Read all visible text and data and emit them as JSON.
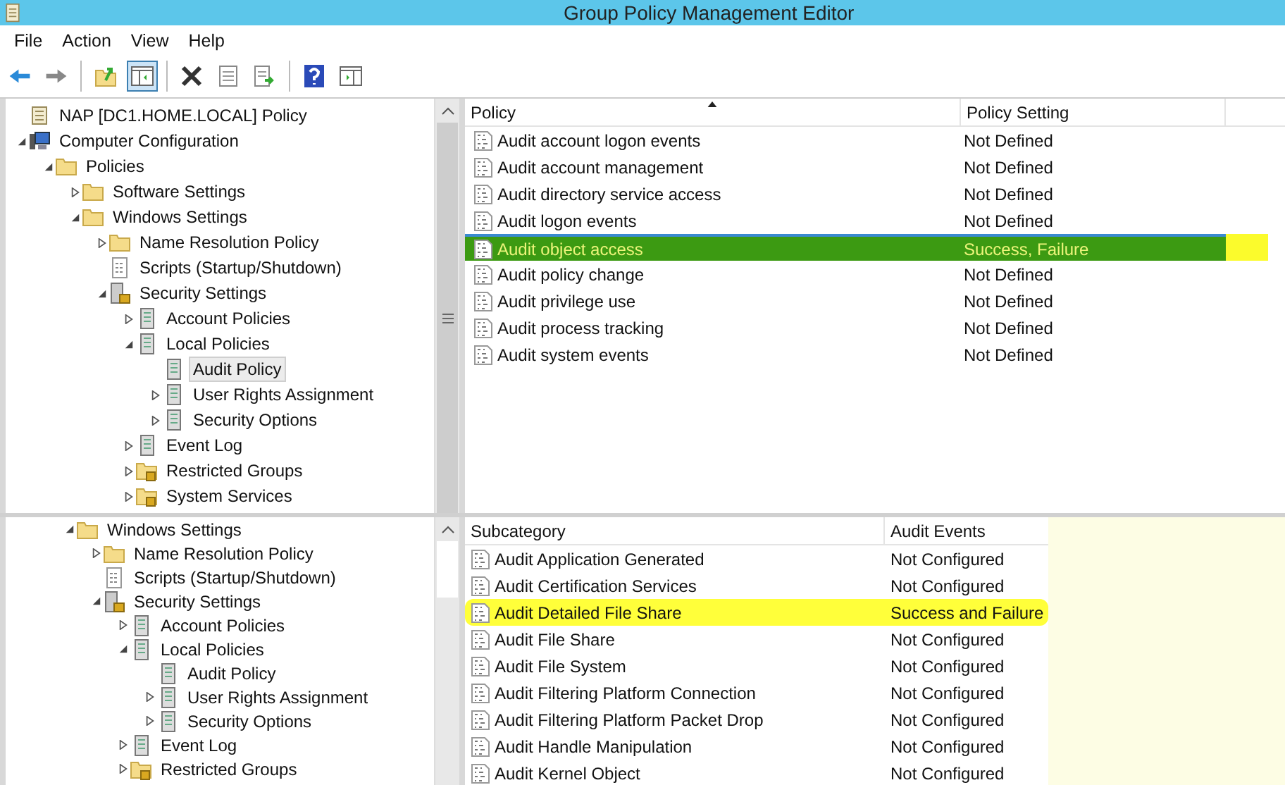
{
  "window": {
    "title": "Group Policy Management Editor"
  },
  "menu": [
    "File",
    "Action",
    "View",
    "Help"
  ],
  "toolbar": [
    {
      "kind": "back",
      "pressed": false
    },
    {
      "kind": "forward",
      "pressed": false
    },
    {
      "kind": "separator"
    },
    {
      "kind": "up",
      "pressed": false
    },
    {
      "kind": "tree",
      "pressed": true
    },
    {
      "kind": "separator"
    },
    {
      "kind": "delete",
      "pressed": false
    },
    {
      "kind": "properties",
      "pressed": false
    },
    {
      "kind": "export",
      "pressed": false
    },
    {
      "kind": "separator"
    },
    {
      "kind": "help",
      "pressed": false
    },
    {
      "kind": "pane",
      "pressed": false
    }
  ],
  "top_pane": {
    "tree": [
      {
        "label": "NAP [DC1.HOME.LOCAL] Policy",
        "kind": "policy",
        "selected": false
      },
      {
        "label": "Computer Configuration",
        "kind": "computer",
        "selected": false,
        "expanded": true,
        "children": [
          {
            "label": "Policies",
            "kind": "folder",
            "selected": false,
            "expanded": true,
            "children": [
              {
                "label": "Software Settings",
                "kind": "folder",
                "selected": false,
                "expanded": false
              },
              {
                "label": "Windows Settings",
                "kind": "folder",
                "selected": false,
                "expanded": true,
                "children": [
                  {
                    "label": "Name Resolution Policy",
                    "kind": "folder",
                    "selected": false,
                    "expanded": false
                  },
                  {
                    "label": "Scripts (Startup/Shutdown)",
                    "kind": "script",
                    "selected": false
                  },
                  {
                    "label": "Security Settings",
                    "kind": "security",
                    "selected": false,
                    "expanded": true,
                    "children": [
                      {
                        "label": "Account Policies",
                        "kind": "group",
                        "selected": false,
                        "expanded": false
                      },
                      {
                        "label": "Local Policies",
                        "kind": "group",
                        "selected": false,
                        "expanded": true,
                        "children": [
                          {
                            "label": "Audit Policy",
                            "kind": "group",
                            "selected": true
                          },
                          {
                            "label": "User Rights Assignment",
                            "kind": "group",
                            "selected": false,
                            "expanded": false
                          },
                          {
                            "label": "Security Options",
                            "kind": "group",
                            "selected": false,
                            "expanded": false
                          }
                        ]
                      },
                      {
                        "label": "Event Log",
                        "kind": "group",
                        "selected": false,
                        "expanded": false
                      },
                      {
                        "label": "Restricted Groups",
                        "kind": "locked-folder",
                        "selected": false,
                        "expanded": false
                      },
                      {
                        "label": "System Services",
                        "kind": "locked-folder",
                        "selected": false,
                        "expanded": false
                      }
                    ]
                  }
                ]
              }
            ]
          }
        ]
      }
    ],
    "list": {
      "columns": [
        {
          "label": "Policy",
          "sorted": true
        },
        {
          "label": "Policy Setting",
          "sorted": false
        }
      ],
      "rows": [
        {
          "policy": "Audit account logon events",
          "setting": "Not Defined",
          "selected": false
        },
        {
          "policy": "Audit account management",
          "setting": "Not Defined",
          "selected": false
        },
        {
          "policy": "Audit directory service access",
          "setting": "Not Defined",
          "selected": false
        },
        {
          "policy": "Audit logon events",
          "setting": "Not Defined",
          "selected": false
        },
        {
          "policy": "Audit object access",
          "setting": "Success, Failure",
          "selected": true
        },
        {
          "policy": "Audit policy change",
          "setting": "Not Defined",
          "selected": false
        },
        {
          "policy": "Audit privilege use",
          "setting": "Not Defined",
          "selected": false
        },
        {
          "policy": "Audit process tracking",
          "setting": "Not Defined",
          "selected": false
        },
        {
          "policy": "Audit system events",
          "setting": "Not Defined",
          "selected": false
        }
      ]
    }
  },
  "bottom_pane": {
    "tree": [
      {
        "label": "Windows Settings",
        "kind": "folder",
        "selected": false,
        "expanded": true,
        "children": [
          {
            "label": "Name Resolution Policy",
            "kind": "folder",
            "selected": false,
            "expanded": false
          },
          {
            "label": "Scripts (Startup/Shutdown)",
            "kind": "script",
            "selected": false
          },
          {
            "label": "Security Settings",
            "kind": "security",
            "selected": false,
            "expanded": true,
            "children": [
              {
                "label": "Account Policies",
                "kind": "group",
                "selected": false,
                "expanded": false
              },
              {
                "label": "Local Policies",
                "kind": "group",
                "selected": false,
                "expanded": true,
                "children": [
                  {
                    "label": "Audit Policy",
                    "kind": "group",
                    "selected": false
                  },
                  {
                    "label": "User Rights Assignment",
                    "kind": "group",
                    "selected": false,
                    "expanded": false
                  },
                  {
                    "label": "Security Options",
                    "kind": "group",
                    "selected": false,
                    "expanded": false
                  }
                ]
              },
              {
                "label": "Event Log",
                "kind": "group",
                "selected": false,
                "expanded": false
              },
              {
                "label": "Restricted Groups",
                "kind": "locked-folder",
                "selected": false,
                "expanded": false
              }
            ]
          }
        ]
      }
    ],
    "list": {
      "columns": [
        {
          "label": "Subcategory",
          "sorted": false
        },
        {
          "label": "Audit Events",
          "sorted": false
        }
      ],
      "rows": [
        {
          "subcategory": "Audit Application Generated",
          "audit_events": "Not Configured",
          "highlighted": false
        },
        {
          "subcategory": "Audit Certification Services",
          "audit_events": "Not Configured",
          "highlighted": false
        },
        {
          "subcategory": "Audit Detailed File Share",
          "audit_events": "Success and Failure",
          "highlighted": true
        },
        {
          "subcategory": "Audit File Share",
          "audit_events": "Not Configured",
          "highlighted": false
        },
        {
          "subcategory": "Audit File System",
          "audit_events": "Not Configured",
          "highlighted": false
        },
        {
          "subcategory": "Audit Filtering Platform Connection",
          "audit_events": "Not Configured",
          "highlighted": false
        },
        {
          "subcategory": "Audit Filtering Platform Packet Drop",
          "audit_events": "Not Configured",
          "highlighted": false
        },
        {
          "subcategory": "Audit Handle Manipulation",
          "audit_events": "Not Configured",
          "highlighted": false
        },
        {
          "subcategory": "Audit Kernel Object",
          "audit_events": "Not Configured",
          "highlighted": false
        }
      ]
    }
  }
}
